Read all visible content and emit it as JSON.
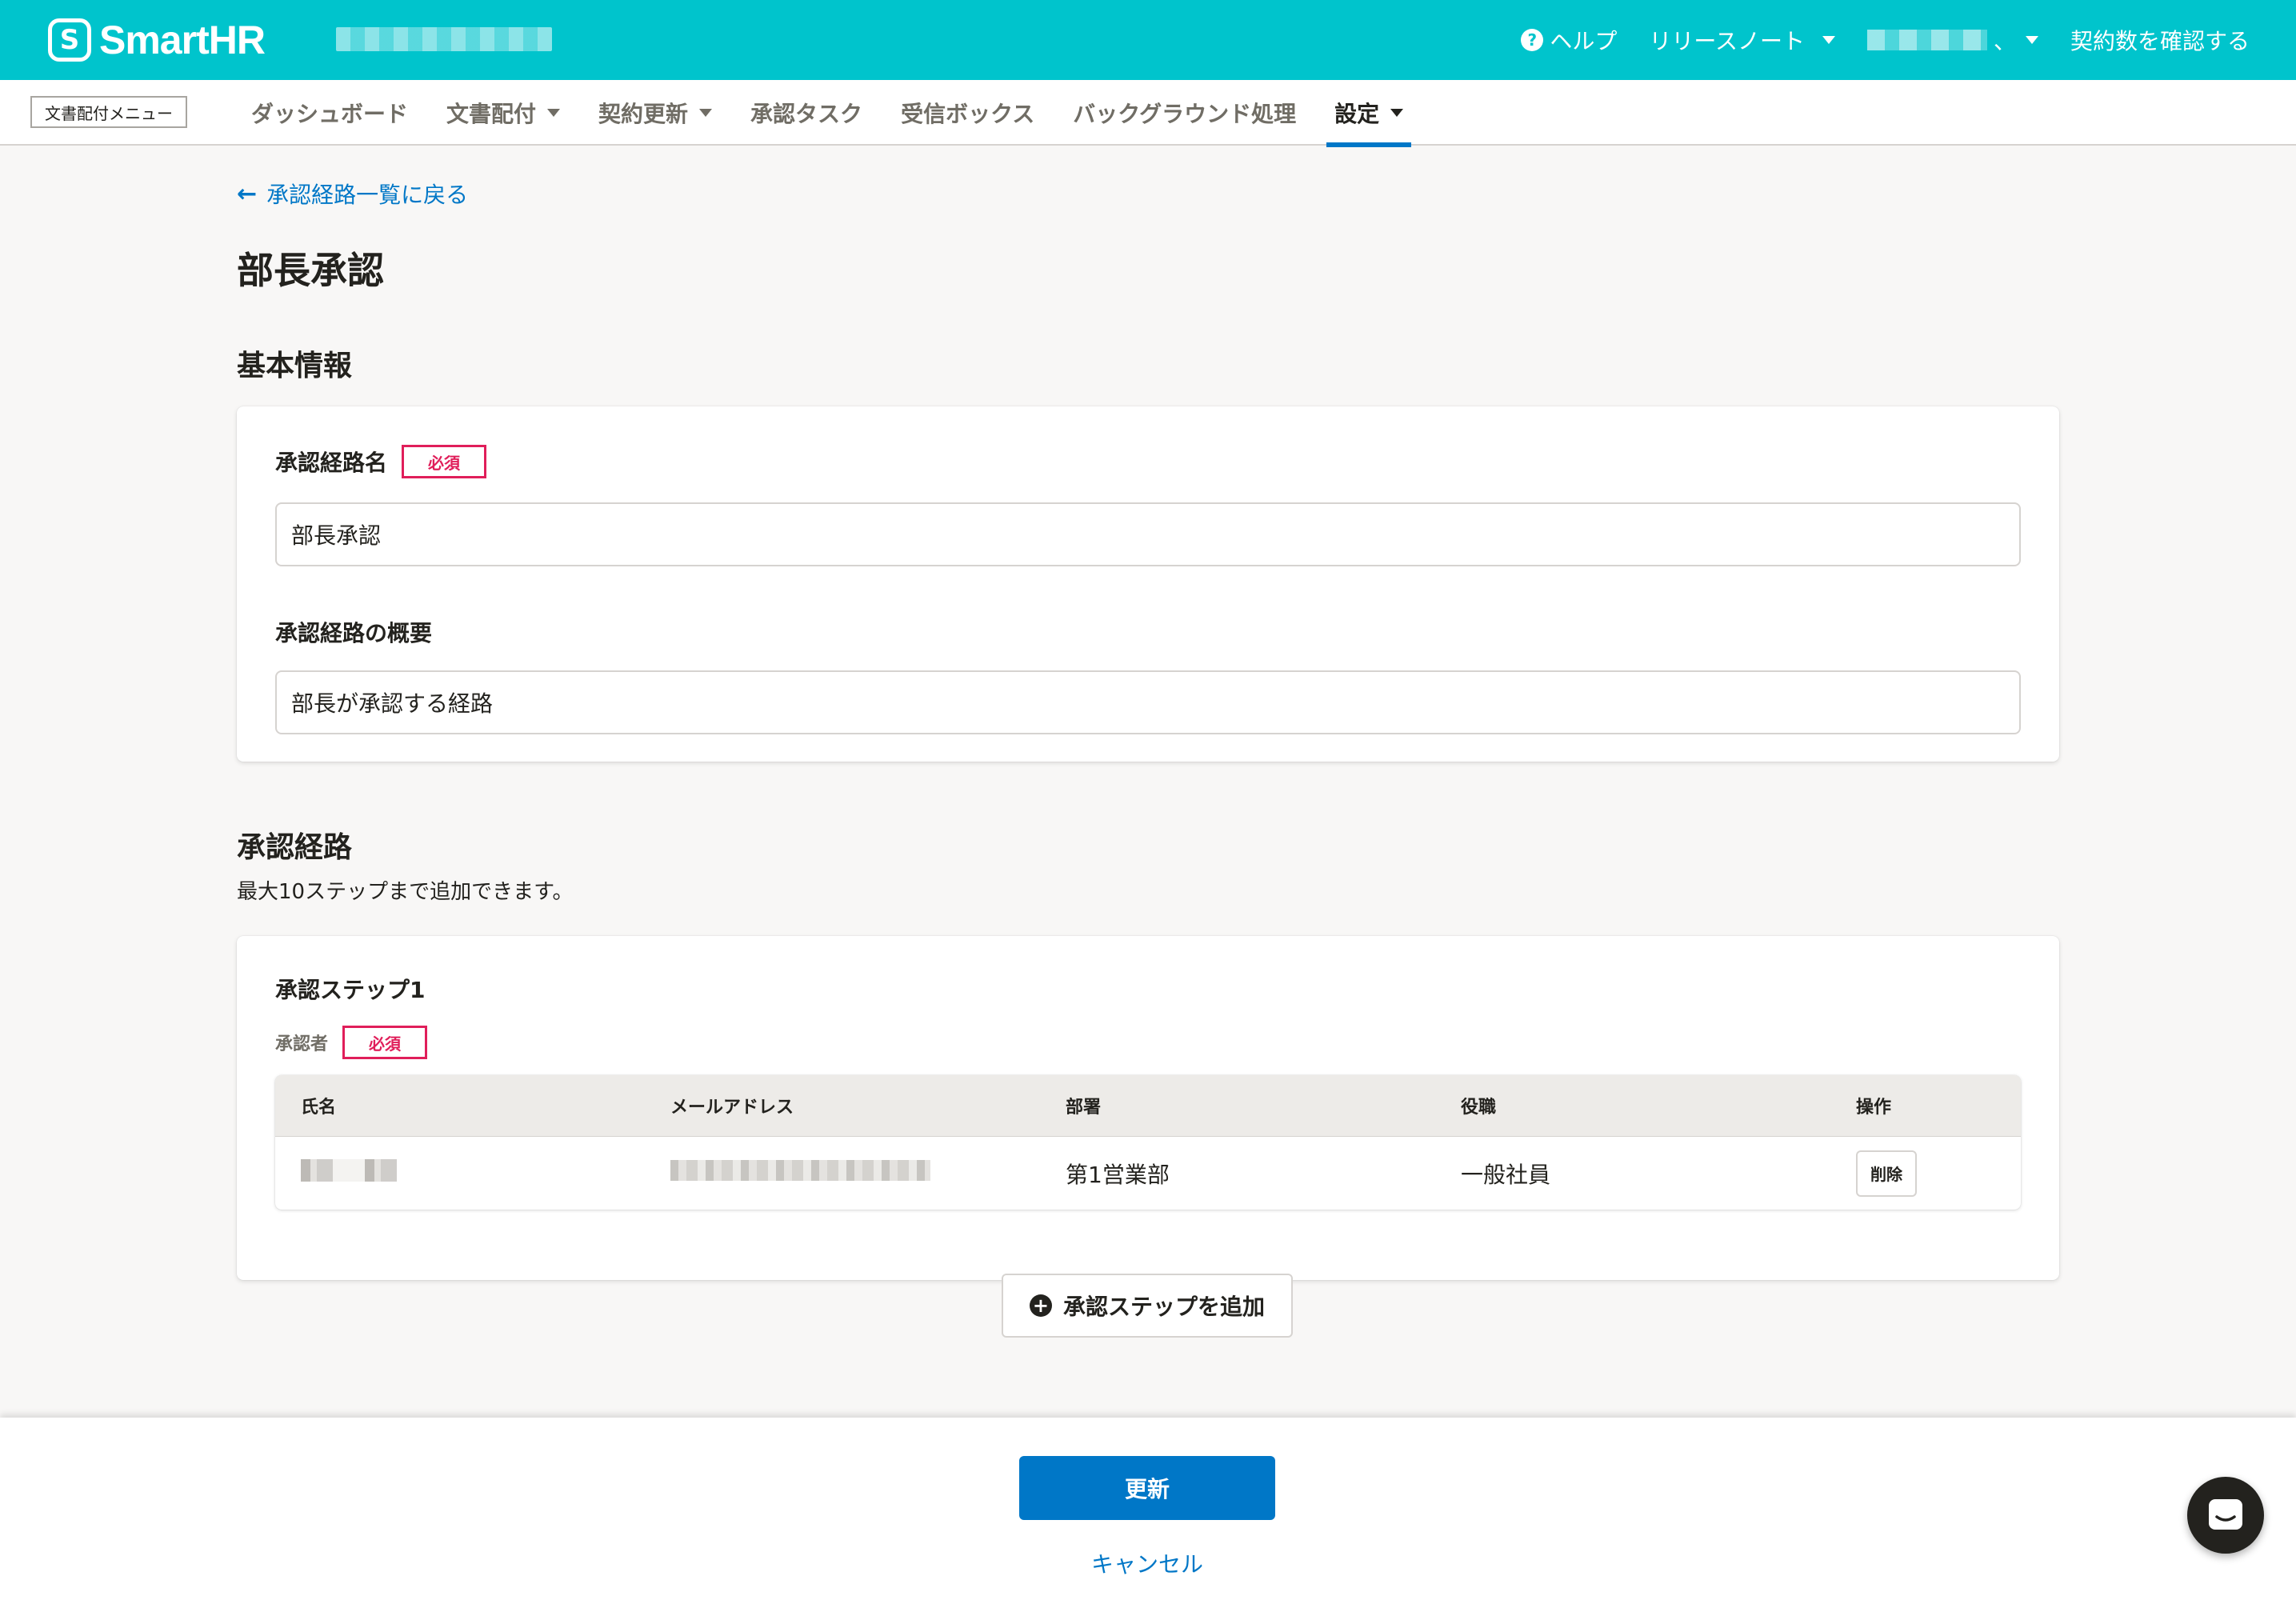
{
  "header": {
    "logo_mark": "S",
    "logo_text": "SmartHR",
    "nav": [
      {
        "label": "ヘルプ",
        "icon": "help-icon"
      },
      {
        "label": "リリースノート",
        "icon": "chevron-down-icon"
      },
      {
        "label": "、",
        "icon": "chevron-down-icon"
      },
      {
        "label": "契約数を確認する"
      }
    ]
  },
  "subnav": {
    "menu_badge": "文書配付メニュー",
    "items": [
      {
        "label": "ダッシュボード"
      },
      {
        "label": "文書配付"
      },
      {
        "label": "契約更新"
      },
      {
        "label": "承認タスク"
      },
      {
        "label": "受信ボックス"
      },
      {
        "label": "バックグラウンド処理"
      },
      {
        "label": "設定"
      }
    ]
  },
  "main": {
    "back_link": "承認経路一覧に戻る",
    "page_title": "部長承認",
    "basic_info": {
      "section_title": "基本情報",
      "name_label": "承認経路名",
      "required_badge": "必須",
      "name_value": "部長承認",
      "summary_label": "承認経路の概要",
      "summary_value": "部長が承認する経路"
    },
    "route": {
      "section_title": "承認経路",
      "description": "最大10ステップまで追加できます。",
      "step_title": "承認ステップ1",
      "approver_label": "承認者",
      "required_badge": "必須",
      "columns": [
        "氏名",
        "メールアドレス",
        "部署",
        "役職",
        "操作"
      ],
      "rows": [
        {
          "department": "第1営業部",
          "position": "一般社員",
          "action": "削除"
        }
      ],
      "add_step_label": "承認ステップを追加"
    }
  },
  "footer": {
    "update_label": "更新",
    "cancel_label": "キャンセル"
  },
  "colors": {
    "brand": "#00c4cc",
    "primary": "#0077c7",
    "danger": "#e01e5a"
  }
}
